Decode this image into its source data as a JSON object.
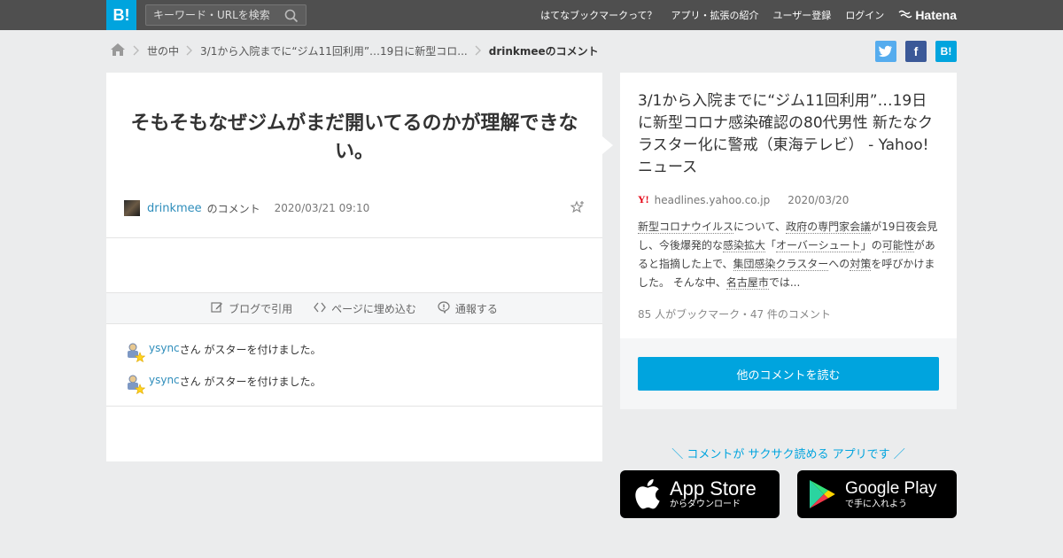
{
  "header": {
    "logo": "B!",
    "search_placeholder": "キーワード・URLを検索",
    "nav": [
      "はてなブックマークって？",
      "アプリ・拡張の紹介",
      "ユーザー登録",
      "ログイン"
    ],
    "brand": "Hatena"
  },
  "breadcrumb": {
    "items": [
      "世の中",
      "3/1から入院までに“ジム11回利用”…19日に新型コロ..."
    ],
    "current": "drinkmeeのコメント"
  },
  "comment": {
    "text": "そもそもなぜジムがまだ開いてるのかが理解できない。",
    "username": "drinkmee",
    "suffix": "のコメント",
    "date": "2020/03/21 09:10"
  },
  "actions": [
    "ブログで引用",
    "ページに埋め込む",
    "通報する"
  ],
  "stars": [
    {
      "user": "ysync",
      "text": "さん がスターを付けました。"
    },
    {
      "user": "ysync",
      "text": "さん がスターを付けました。"
    }
  ],
  "entry": {
    "title": "3/1から入院までに“ジム11回利用”…19日に新型コロナ感染確認の80代男性 新たなクラスター化に警戒（東海テレビ） - Yahoo!ニュース",
    "source_icon": "Y!",
    "domain": "headlines.yahoo.co.jp",
    "date": "2020/03/20",
    "summary_parts": [
      {
        "t": "新型コロナウイルス",
        "kw": true
      },
      {
        "t": "について、",
        "kw": false
      },
      {
        "t": "政府の専門家会議",
        "kw": true
      },
      {
        "t": "が19日夜会見し、今後爆発的な",
        "kw": false
      },
      {
        "t": "感染拡大",
        "kw": true
      },
      {
        "t": "「",
        "kw": false
      },
      {
        "t": "オーバーシュート",
        "kw": true
      },
      {
        "t": "」の",
        "kw": false
      },
      {
        "t": "可能性",
        "kw": true
      },
      {
        "t": "があると指摘した上で、",
        "kw": false
      },
      {
        "t": "集団感染クラスター",
        "kw": true
      },
      {
        "t": "への",
        "kw": false
      },
      {
        "t": "対策",
        "kw": true
      },
      {
        "t": "を呼びかけました。 そんな中、",
        "kw": false
      },
      {
        "t": "名古屋市",
        "kw": true
      },
      {
        "t": "では...",
        "kw": false
      }
    ],
    "counts": "85 人がブックマーク・47 件のコメント",
    "more_button": "他のコメントを読む"
  },
  "app_promo": {
    "text": "＼ コメントが サクサク読める アプリです ／",
    "appstore_main": "App Store",
    "appstore_sub": "からダウンロード",
    "googleplay_main": "Google Play",
    "googleplay_sub": "で手に入れよう"
  },
  "colors": {
    "accent": "#00a4de",
    "link": "#2e8dbb",
    "topbar": "#4f4f4f",
    "background": "#ebeced"
  },
  "icons": [
    "search-icon",
    "home-icon",
    "chevron-right-icon",
    "twitter-icon",
    "facebook-icon",
    "hatebu-icon",
    "star-add-icon",
    "edit-icon",
    "code-icon",
    "report-icon",
    "user-icon",
    "star-icon",
    "apple-icon",
    "google-play-icon",
    "hatena-icon"
  ]
}
